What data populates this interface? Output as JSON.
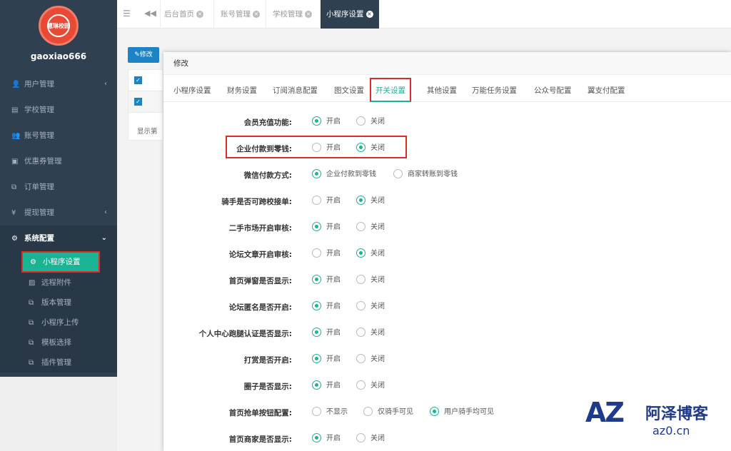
{
  "sidebar": {
    "logo_text": "慧琳校园",
    "username": "gaoxiao666",
    "items": [
      {
        "label": "用户管理",
        "icon": "user-icon",
        "glyph": "👤",
        "arrow": "‹"
      },
      {
        "label": "学校管理",
        "icon": "building-icon",
        "glyph": "▤",
        "arrow": ""
      },
      {
        "label": "账号管理",
        "icon": "users-icon",
        "glyph": "👥",
        "arrow": ""
      },
      {
        "label": "优惠券管理",
        "icon": "coupon-icon",
        "glyph": "▣",
        "arrow": ""
      },
      {
        "label": "订单管理",
        "icon": "copy-icon",
        "glyph": "⧉",
        "arrow": ""
      },
      {
        "label": "提现管理",
        "icon": "yen-icon",
        "glyph": "¥",
        "arrow": "‹"
      },
      {
        "label": "系统配置",
        "icon": "gear-icon",
        "glyph": "⚙",
        "arrow": "⌄"
      }
    ],
    "sub_items": [
      {
        "label": "小程序设置",
        "icon": "gear-icon",
        "glyph": "⚙"
      },
      {
        "label": "远程附件",
        "icon": "image-icon",
        "glyph": "▨"
      },
      {
        "label": "版本管理",
        "icon": "copy-icon",
        "glyph": "⧉"
      },
      {
        "label": "小程序上传",
        "icon": "copy-icon",
        "glyph": "⧉"
      },
      {
        "label": "模板选择",
        "icon": "copy-icon",
        "glyph": "⧉"
      },
      {
        "label": "插件管理",
        "icon": "copy-icon",
        "glyph": "⧉"
      }
    ]
  },
  "topbar": {
    "tabs": [
      "后台首页",
      "账号管理",
      "学校管理",
      "小程序设置"
    ],
    "close_glyph": "×"
  },
  "background": {
    "edit_button": "✎修改",
    "footer_text": "显示第"
  },
  "modal": {
    "title": "修改",
    "tabs": [
      "小程序设置",
      "财务设置",
      "订阅消息配置",
      "图文设置",
      "开关设置",
      "其他设置",
      "万能任务设置",
      "公众号配置",
      "翼支付配置"
    ],
    "active_tab": 4,
    "rows": [
      {
        "label": "会员充值功能:",
        "options": [
          "开启",
          "关闭"
        ],
        "selected": 0
      },
      {
        "label": "企业付款到零钱:",
        "options": [
          "开启",
          "关闭"
        ],
        "selected": 1
      },
      {
        "label": "微信付款方式:",
        "options": [
          "企业付款到零钱",
          "商家转账到零钱"
        ],
        "selected": 0
      },
      {
        "label": "骑手是否可跨校接单:",
        "options": [
          "开启",
          "关闭"
        ],
        "selected": 1
      },
      {
        "label": "二手市场开启审核:",
        "options": [
          "开启",
          "关闭"
        ],
        "selected": 0
      },
      {
        "label": "论坛文章开启审核:",
        "options": [
          "开启",
          "关闭"
        ],
        "selected": 1
      },
      {
        "label": "首页弹窗是否显示:",
        "options": [
          "开启",
          "关闭"
        ],
        "selected": 0
      },
      {
        "label": "论坛匿名是否开启:",
        "options": [
          "开启",
          "关闭"
        ],
        "selected": 0
      },
      {
        "label": "个人中心跑腿认证是否显示:",
        "options": [
          "开启",
          "关闭"
        ],
        "selected": 0
      },
      {
        "label": "打赏是否开启:",
        "options": [
          "开启",
          "关闭"
        ],
        "selected": 0
      },
      {
        "label": "圈子是否显示:",
        "options": [
          "开启",
          "关闭"
        ],
        "selected": 0
      },
      {
        "label": "首页抢单按钮配置:",
        "options": [
          "不显示",
          "仅骑手可见",
          "用户骑手均可见"
        ],
        "selected": 2
      },
      {
        "label": "首页商家是否显示:",
        "options": [
          "开启",
          "关闭"
        ],
        "selected": 0
      }
    ]
  },
  "watermark": {
    "brand": "AZ",
    "name": "阿泽博客",
    "domain": "az0.cn"
  },
  "colors": {
    "sidebar_bg": "#2f4050",
    "accent": "#1ab394",
    "highlight": "#e02b2b",
    "brand_blue": "#1e3a8a"
  }
}
